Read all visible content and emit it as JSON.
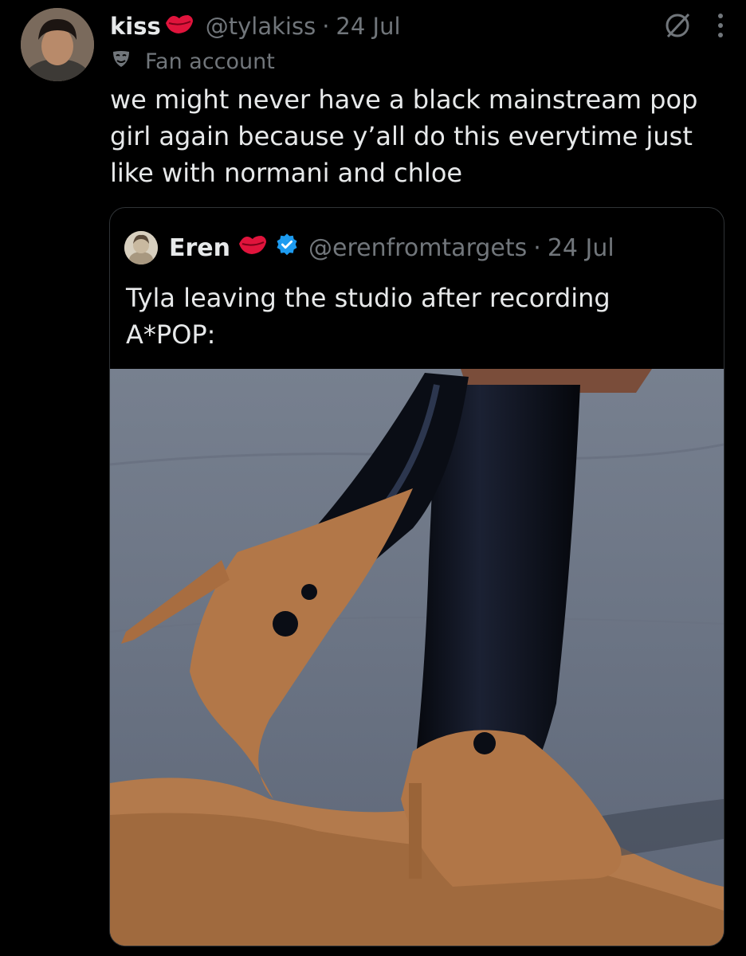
{
  "tweet": {
    "display_name": "kiss",
    "handle": "@tylakiss",
    "separator": "·",
    "date": "24 Jul",
    "account_label": "Fan account",
    "text": "we might never have a black mainstream pop\ngirl again because y’all do this everytime just\nlike with normani and chloe",
    "icons": [
      "lips-emoji-icon",
      "grok-icon",
      "more-icon",
      "mask-icon"
    ]
  },
  "quote": {
    "display_name": "Eren",
    "handle": "@erenfromtargets",
    "separator": "·",
    "date": "24 Jul",
    "text": "Tyla leaving the studio after recording\nA*POP:",
    "icons": [
      "lips-emoji-icon",
      "verified-badge-icon"
    ]
  },
  "colors": {
    "background": "#000000",
    "text": "#e7e9ea",
    "secondary": "#71767b",
    "verified": "#1d9bf0",
    "lips": "#e0143c",
    "border": "#2f3336"
  }
}
